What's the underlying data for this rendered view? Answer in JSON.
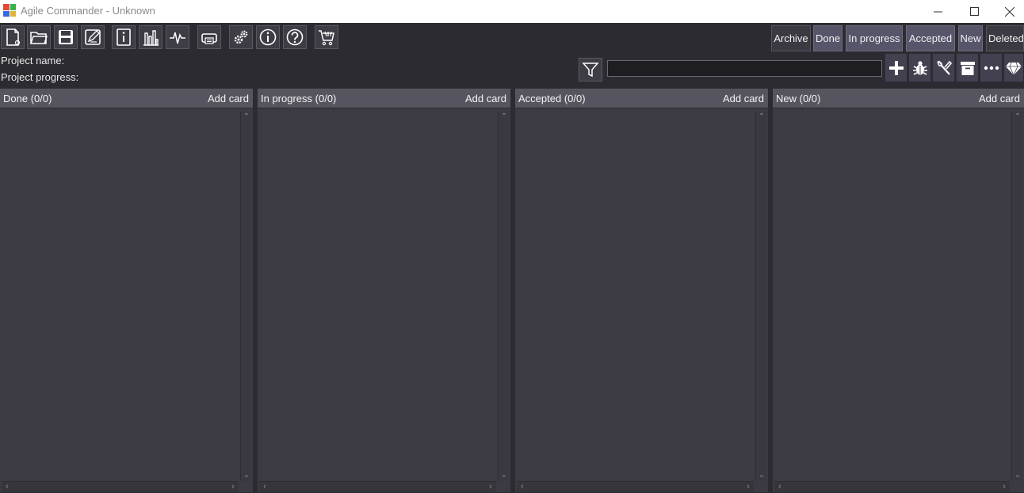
{
  "window": {
    "title": "Agile Commander - Unknown",
    "minimize": "—",
    "maximize": "☐",
    "close": "✕"
  },
  "toolbar": {
    "icons": [
      "new-file-icon",
      "open-folder-icon",
      "save-icon",
      "edit-icon",
      "info-page-icon",
      "bar-chart-icon",
      "pulse-icon",
      "print-icon",
      "settings-gears-icon",
      "about-info-icon",
      "help-icon",
      "shop-cart-icon"
    ]
  },
  "project": {
    "name_label": "Project name:",
    "progress_label": "Project progress:"
  },
  "status_filters": [
    {
      "label": "Archive",
      "active": false
    },
    {
      "label": "Done",
      "active": true
    },
    {
      "label": "In progress",
      "active": true
    },
    {
      "label": "Accepted",
      "active": true
    },
    {
      "label": "New",
      "active": true
    },
    {
      "label": "Deleted",
      "active": false
    }
  ],
  "search": {
    "value": "",
    "placeholder": ""
  },
  "card_types": [
    "plus-icon",
    "bug-icon",
    "tools-icon",
    "archive-box-icon",
    "more-icon",
    "diamond-icon"
  ],
  "columns": [
    {
      "title": "Done (0/0)",
      "add": "Add card"
    },
    {
      "title": "In progress (0/0)",
      "add": "Add card"
    },
    {
      "title": "Accepted (0/0)",
      "add": "Add card"
    },
    {
      "title": "New (0/0)",
      "add": "Add card"
    }
  ],
  "colors": {
    "background": "#2c2b31",
    "column": "#3c3b44",
    "header": "#56555f",
    "button_active": "#56556a"
  }
}
